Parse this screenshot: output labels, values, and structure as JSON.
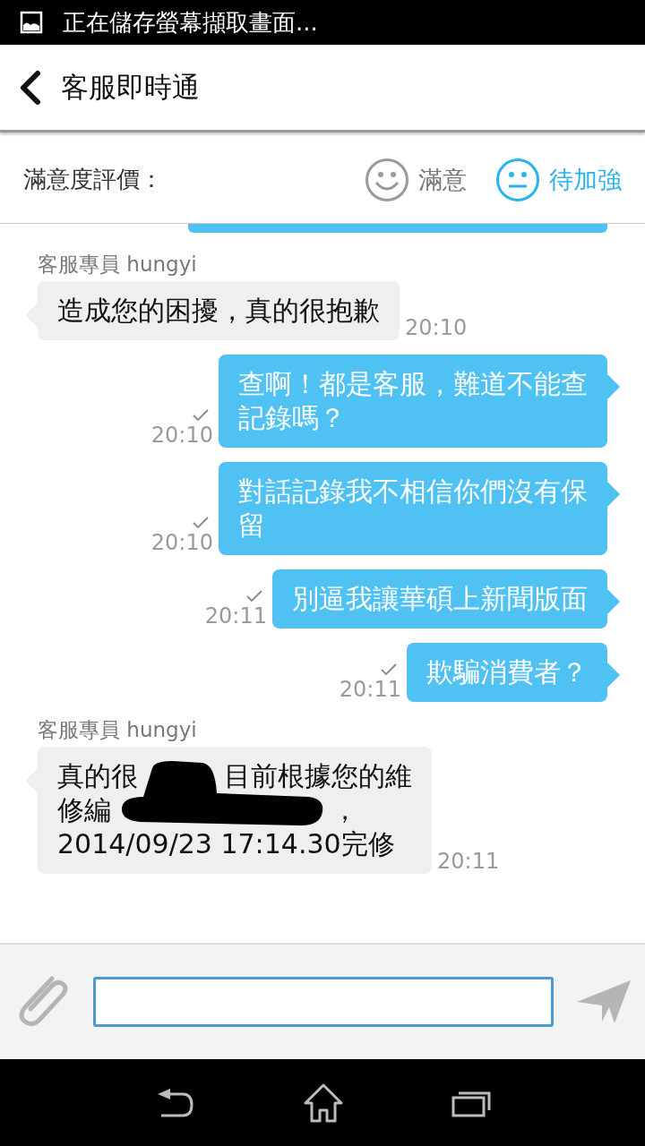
{
  "status_bar": {
    "notification": "正在儲存螢幕擷取畫面..."
  },
  "header": {
    "title": "客服即時通"
  },
  "rating": {
    "label": "滿意度評價：",
    "options": [
      {
        "kind": "smile",
        "label": "滿意",
        "selected": false
      },
      {
        "kind": "neutral",
        "label": "待加強",
        "selected": true
      }
    ]
  },
  "messages": [
    {
      "kind": "agent",
      "sender": "客服專員 hungyi",
      "text": "造成您的困擾，真的很抱歉",
      "time": "20:10"
    },
    {
      "kind": "user",
      "text": "查啊！都是客服，難道不能查記錄嗎？",
      "time": "20:10",
      "read": true
    },
    {
      "kind": "user",
      "text": "對話記錄我不相信你們沒有保留",
      "time": "20:10",
      "read": true
    },
    {
      "kind": "user",
      "text": "別逼我讓華碩上新聞版面",
      "time": "20:11",
      "read": true
    },
    {
      "kind": "user",
      "text": "欺騙消費者？",
      "time": "20:11",
      "read": true
    },
    {
      "kind": "agent_redacted",
      "sender": "客服專員 hungyi",
      "lines": [
        [
          "真的很",
          "目前根據您的維"
        ],
        [
          "修編",
          "，"
        ],
        [
          "2014/09/23 17:14.30完修"
        ]
      ],
      "time": "20:11"
    }
  ]
}
